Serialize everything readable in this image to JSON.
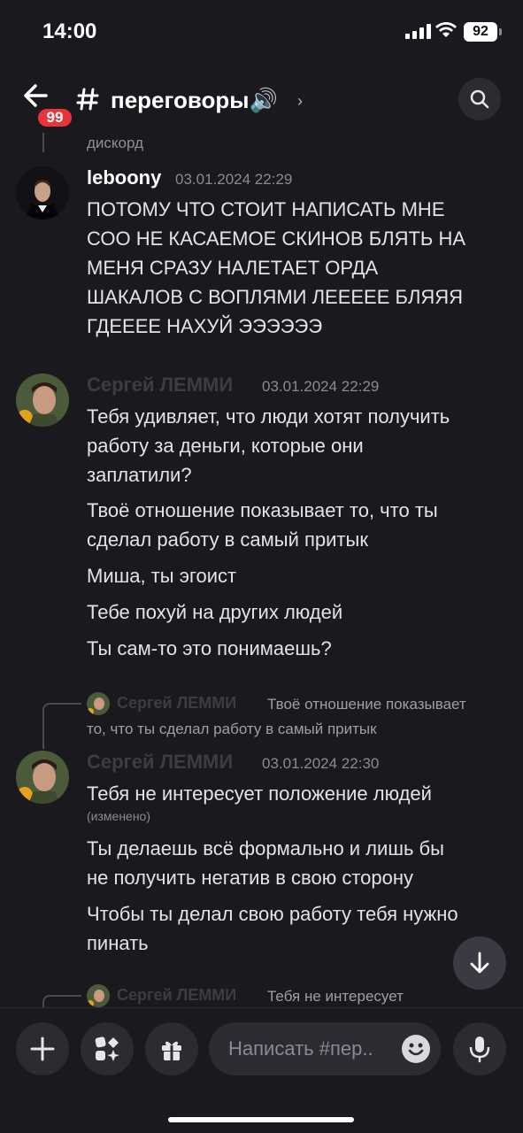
{
  "status_bar": {
    "time": "14:00",
    "battery": "92"
  },
  "header": {
    "unread_count": "99",
    "channel_name": "переговоры🔊"
  },
  "messages": {
    "top_reply_fragment": "дискорд",
    "msg1": {
      "author": "leboony",
      "timestamp": "03.01.2024 22:29",
      "lines": [
        "ПОТОМУ ЧТО СТОИТ НАПИСАТЬ МНЕ",
        "СОО НЕ КАСАЕМОЕ СКИНОВ БЛЯТЬ НА",
        "МЕНЯ СРАЗУ НАЛЕТАЕТ ОРДА",
        "ШАКАЛОВ С ВОПЛЯМИ ЛЕЕЕЕЕ БЛЯЯЯ",
        "ГДЕЕЕЕ НАХУЙ ЭЭЭЭЭЭ"
      ]
    },
    "msg2": {
      "author": "Сергей ЛЕММИ",
      "timestamp": "03.01.2024 22:29",
      "groups": [
        [
          "Тебя удивляет, что люди хотят получить",
          "работу за деньги, которые они",
          "заплатили?"
        ],
        [
          "Твоё отношение показывает то, что ты",
          "сделал работу в самый притык"
        ],
        [
          "Миша, ты эгоист"
        ],
        [
          "Тебе похуй на других людей"
        ],
        [
          "Ты сам-то это понимаешь?"
        ]
      ]
    },
    "reply1": {
      "author": "Сергей ЛЕММИ",
      "text_line1": "Твоё отношение показывает",
      "text_line2": "то, что ты сделал работу в самый притык"
    },
    "msg3": {
      "author": "Сергей ЛЕММИ",
      "timestamp": "03.01.2024 22:30",
      "line1": "Тебя не интересует положение людей",
      "edited": "(изменено)",
      "groups": [
        [
          "Ты делаешь всё формально и лишь бы",
          "не получить негатив в свою сторону"
        ],
        [
          "Чтобы ты делал свою работу тебя нужно",
          "пинать"
        ]
      ]
    },
    "reply2": {
      "author": "Сергей ЛЕММИ",
      "text": "Тебя не интересует"
    }
  },
  "composer": {
    "placeholder": "Написать #пер.."
  },
  "icons": [
    "back-arrow-icon",
    "hash-icon",
    "chevron-right-icon",
    "search-icon",
    "arrow-down-icon",
    "plus-icon",
    "apps-icon",
    "gift-icon",
    "emoji-icon",
    "microphone-icon"
  ],
  "colors": {
    "background": "#1a1a1e",
    "badge": "#e8343b",
    "button": "#2b2b31"
  }
}
